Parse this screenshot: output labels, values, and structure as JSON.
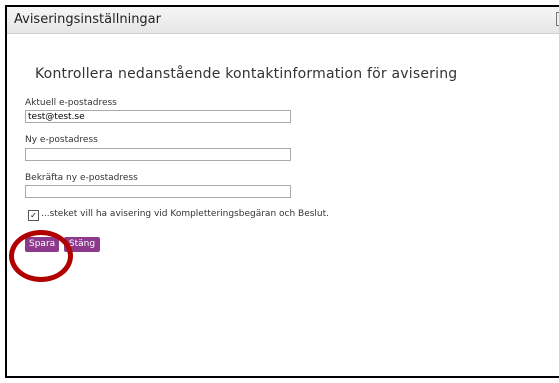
{
  "dialog": {
    "title": "Aviseringsinställningar",
    "close_label": "✕",
    "heading": "Kontrollera nedanstående kontaktinformation för avisering"
  },
  "form": {
    "current_email_label": "Aktuell e-postadress",
    "current_email_value": "test@test.se",
    "new_email_label": "Ny e-postadress",
    "new_email_value": "",
    "confirm_email_label": "Bekräfta ny e-postadress",
    "confirm_email_value": "",
    "notify_checkbox_checked": true,
    "notify_checkbox_label": "...steket vill ha avisering vid Kompletteringsbegäran och Beslut."
  },
  "buttons": {
    "save_label": "Spara",
    "close_label": "Stäng"
  },
  "colors": {
    "button_bg": "#8d3a8d",
    "annotation": "#b00000"
  },
  "icons": {
    "close": "close-icon",
    "checkbox": "checkmark-icon"
  }
}
